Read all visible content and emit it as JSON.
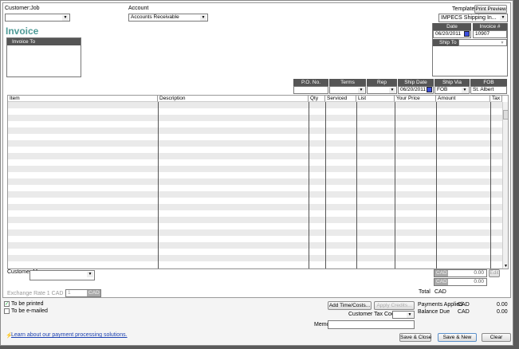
{
  "header": {
    "customer_job_label": "Customer:Job",
    "customer_job_value": "",
    "account_label": "Account",
    "account_value": "Accounts Receivable",
    "template_label": "Template",
    "print_preview": "Print Preview",
    "template_value": "IMPECS Shipping In..."
  },
  "form": {
    "title": "Invoice",
    "invoice_to": "Invoice To",
    "date_label": "Date",
    "date": "06/20/2011",
    "invoice_no_label": "Invoice #",
    "invoice_no": "10907",
    "ship_to_label": "Ship To",
    "ship_to_value": ""
  },
  "fields": {
    "po_label": "P.O. No.",
    "po": "",
    "terms_label": "Terms",
    "terms": "",
    "rep_label": "Rep",
    "rep": "",
    "ship_date_label": "Ship Date",
    "ship_date": "06/20/2011",
    "ship_via_label": "Ship Via",
    "ship_via": "FOB",
    "fob_label": "FOB",
    "fob": "St. Albert"
  },
  "table": {
    "columns": [
      "Item",
      "Description",
      "Qty",
      "Serviced",
      "List",
      "Your Price",
      "Amount",
      "Tax"
    ]
  },
  "footer": {
    "customer_message_label": "Customer Message",
    "exchange_label": "Exchange Rate 1 CAD =",
    "exchange_value": "1",
    "exchange_currency": "CAD",
    "subtotal_currency": "CAD",
    "subtotal": "0.00",
    "edit": "Edit",
    "tax_currency": "CAD",
    "tax": "0.00",
    "total_label": "Total",
    "total_currency": "CAD",
    "to_be_printed": "To be printed",
    "to_be_printed_checked": true,
    "to_be_emailed": "To be e-mailed",
    "to_be_emailed_checked": false,
    "learn_link": "Learn about our payment processing solutions.",
    "add_time_costs": "Add Time/Costs...",
    "apply_credits": "Apply Credits...",
    "customer_tax_code_label": "Customer Tax Code",
    "memo_label": "Memo",
    "payments_applied_label": "Payments Applied",
    "payments_applied_currency": "CAD",
    "payments_applied": "0.00",
    "balance_due_label": "Balance Due",
    "balance_due_currency": "CAD",
    "balance_due": "0.00",
    "save_close": "Save & Close",
    "save_new": "Save & New",
    "clear": "Clear"
  },
  "colors": {
    "title": "#4e9a96",
    "header_bg": "#555555",
    "calendar": "#3b4fe0"
  }
}
